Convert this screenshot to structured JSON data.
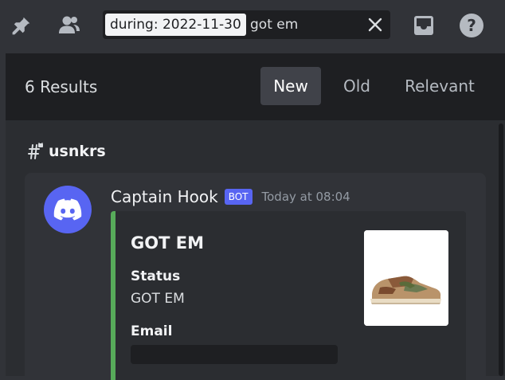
{
  "toolbar": {
    "icons": [
      "pin-icon",
      "members-icon",
      "inbox-icon",
      "help-icon"
    ]
  },
  "search": {
    "filter_chip": "during: 2022-11-30",
    "query": "got em"
  },
  "results": {
    "count_label": "6 Results",
    "sort_tabs": [
      {
        "label": "New",
        "active": true
      },
      {
        "label": "Old",
        "active": false
      },
      {
        "label": "Relevant",
        "active": false
      }
    ]
  },
  "channel": {
    "name": "usnkrs"
  },
  "message": {
    "author": "Captain Hook",
    "badge": "BOT",
    "timestamp": "Today at 08:04",
    "embed": {
      "title": "GOT EM",
      "fields": [
        {
          "name": "Status",
          "value": "GOT EM"
        },
        {
          "name": "Email",
          "value": ""
        }
      ],
      "accent_color": "#57ab5a"
    }
  },
  "colors": {
    "background": "#313338",
    "panel": "#2b2d31",
    "header": "#1e1f22",
    "blurple": "#5865f2"
  }
}
